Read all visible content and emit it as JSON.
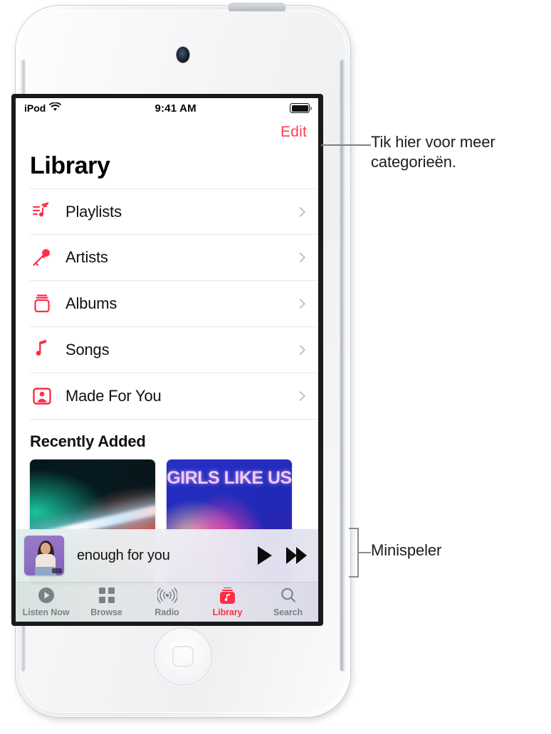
{
  "device": {
    "name": "iPod touch"
  },
  "statusbar": {
    "carrier": "iPod",
    "wifi_icon": "wifi-icon",
    "time": "9:41 AM",
    "battery_icon": "battery-full-icon"
  },
  "nav": {
    "edit_label": "Edit"
  },
  "page": {
    "title": "Library"
  },
  "library_rows": [
    {
      "label": "Playlists",
      "icon": "playlist-note-icon",
      "chevron": "chevron-right-icon"
    },
    {
      "label": "Artists",
      "icon": "microphone-icon",
      "chevron": "chevron-right-icon"
    },
    {
      "label": "Albums",
      "icon": "album-stack-icon",
      "chevron": "chevron-right-icon"
    },
    {
      "label": "Songs",
      "icon": "music-note-icon",
      "chevron": "chevron-right-icon"
    },
    {
      "label": "Made For You",
      "icon": "person-frame-icon",
      "chevron": "chevron-right-icon"
    }
  ],
  "recently_added": {
    "title": "Recently Added",
    "artworks": [
      {
        "name": "artwork-neon-light",
        "caption": ""
      },
      {
        "name": "artwork-girls-like-us",
        "caption": "GIRLS LIKE US"
      }
    ]
  },
  "miniplayer": {
    "track_title": "enough for you",
    "artwork_name": "miniplayer-artwork",
    "play_button": "play-icon",
    "forward_button": "fast-forward-icon"
  },
  "tabbar": {
    "tabs": [
      {
        "label": "Listen Now",
        "icon": "play-circle-icon",
        "active": false
      },
      {
        "label": "Browse",
        "icon": "grid-squares-icon",
        "active": false
      },
      {
        "label": "Radio",
        "icon": "radio-waves-icon",
        "active": false
      },
      {
        "label": "Library",
        "icon": "library-icon",
        "active": true
      },
      {
        "label": "Search",
        "icon": "magnifier-icon",
        "active": false
      }
    ]
  },
  "callouts": {
    "top": "Tik hier voor meer categorieën.",
    "miniplayer": "Minispeler"
  },
  "colors": {
    "accent_red": "#FF2D45",
    "edit_red": "#FF3B4E",
    "tab_inactive": "#7c8187",
    "chevron_gray": "#c2c2c5",
    "callout_line": "#8c8c8c"
  }
}
